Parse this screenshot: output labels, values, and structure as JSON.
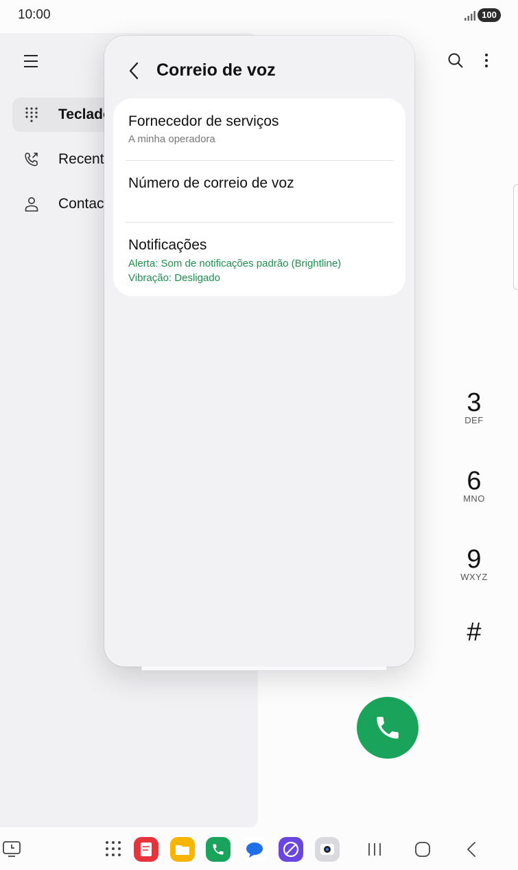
{
  "status_bar": {
    "time": "10:00",
    "battery": "100"
  },
  "background_app": {
    "nav_items": [
      {
        "label": "Teclado",
        "icon": "dialpad-icon",
        "active": true
      },
      {
        "label": "Recentes",
        "icon": "recent-calls-icon",
        "active": false
      },
      {
        "label": "Contactos",
        "icon": "contacts-icon",
        "active": false
      }
    ],
    "dial_keys": [
      {
        "digit": "3",
        "letters": "DEF"
      },
      {
        "digit": "6",
        "letters": "MNO"
      },
      {
        "digit": "9",
        "letters": "WXYZ"
      },
      {
        "digit": "#",
        "letters": ""
      }
    ]
  },
  "dialog": {
    "title": "Correio de voz",
    "items": [
      {
        "title": "Fornecedor de serviços",
        "subtitle": "A minha operadora"
      },
      {
        "title": "Número de correio de voz",
        "subtitle": ""
      },
      {
        "title": "Notificações",
        "subtitle_line1": "Alerta: Som de notificações padrão (Brightline)",
        "subtitle_line2": "Vibração: Desligado"
      }
    ]
  },
  "colors": {
    "accent_green": "#1aa35a",
    "summary_green": "#1e8e4e"
  },
  "taskbar_icons": [
    "recent-apps-icon",
    "app-drawer-icon",
    "notes-app-icon",
    "files-app-icon",
    "phone-app-icon",
    "messages-app-icon",
    "internet-app-icon",
    "camera-app-icon",
    "recents-button-icon",
    "home-button-icon",
    "back-button-icon"
  ]
}
